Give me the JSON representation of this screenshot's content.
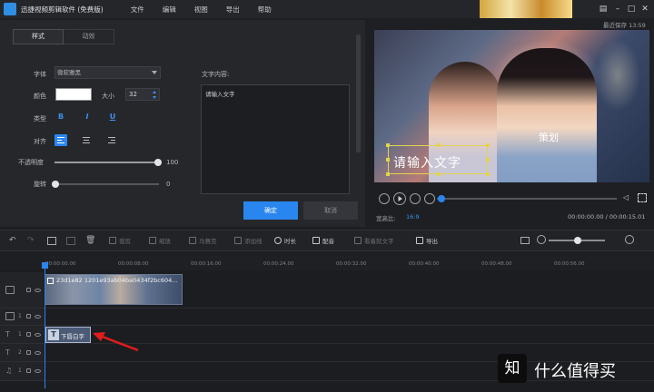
{
  "window": {
    "title": "迅捷视频剪辑软件 (免费版)",
    "menu": [
      "文件",
      "编辑",
      "视图",
      "导出",
      "帮助"
    ],
    "last_saved": "最近保存 13:59"
  },
  "style_panel": {
    "tabs": [
      "样式",
      "动效"
    ],
    "font_label": "字体",
    "font_value": "微软雅黑",
    "color_label": "颜色",
    "size_label": "大小",
    "size_value": "32",
    "type_label": "类型",
    "type_buttons": [
      "B",
      "I",
      "U"
    ],
    "align_label": "对齐",
    "opacity_label": "不透明度",
    "opacity_value": "100",
    "rotation_label": "旋转",
    "rotation_value": "0",
    "text_content_label": "文字内容:",
    "text_content_value": "请输入文字",
    "confirm": "确定",
    "cancel": "取消"
  },
  "preview": {
    "overlay_text": "请输入文字",
    "watermark_char": "策划",
    "aspect_label": "宽高比:",
    "aspect_value": "16:9",
    "time": "00:00:00.00 / 00:00:15.01",
    "progress": 0.0
  },
  "toolbar": {
    "tools": [
      "裁剪",
      "缩放",
      "马赛克",
      "添加线",
      "时长",
      "配音",
      "看着就文字",
      "导出"
    ]
  },
  "timeline": {
    "ticks": [
      "00:00:00.00",
      "00:00:08.00",
      "00:00:16.00",
      "00:00:24.00",
      "00:00:32.00",
      "00:00:40.00",
      "00:00:48.00",
      "00:00:56.00"
    ],
    "video_clip_name": "23d1e82 1201e93ab04ba0434f2bc604...",
    "text_clip_label": "下唇白字",
    "track_labels": [
      "1",
      "1",
      "1",
      "2",
      "1"
    ]
  },
  "watermark": {
    "logo": "知",
    "text": "什么值得买"
  }
}
